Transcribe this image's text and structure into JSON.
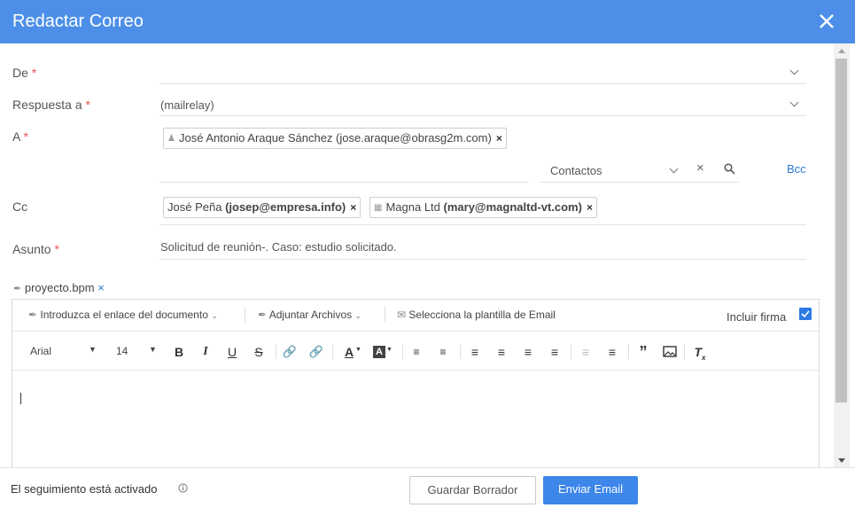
{
  "header": {
    "title": "Redactar Correo"
  },
  "form": {
    "de": {
      "label": "De",
      "value": ""
    },
    "respuesta": {
      "label": "Respuesta a",
      "value": "(mailrelay)"
    },
    "to": {
      "label": "A",
      "chips": [
        "José Antonio Araque Sánchez (jose.araque@obrasg2m.com)"
      ],
      "contacts_placeholder": "Contactos",
      "bcc": "Bcc"
    },
    "cc": {
      "label": "Cc",
      "chips": [
        {
          "name": "José Peña",
          "email": "(josep@empresa.info)"
        },
        {
          "name": "Magna Ltd",
          "email": "(mary@magnaltd-vt.com)"
        }
      ]
    },
    "subject": {
      "label": "Asunto",
      "value": "Solicitud de reunión-. Caso: estudio solicitado."
    },
    "required_mark": "*"
  },
  "attachment": {
    "name": "proyecto.bpm"
  },
  "toolbar": {
    "doc_link": "Introduzca el enlace del documento",
    "attach": "Adjuntar Archivos",
    "template": "Selecciona la plantilla de Email",
    "signature": "Incluir firma",
    "font": "Arial",
    "size": "14"
  },
  "footer": {
    "tracking": "El seguimiento está activado",
    "draft": "Guardar Borrador",
    "send": "Enviar Email"
  },
  "colors": {
    "accent": "#4d8fe8",
    "required": "#e8534a",
    "link": "#2b7bd0"
  }
}
